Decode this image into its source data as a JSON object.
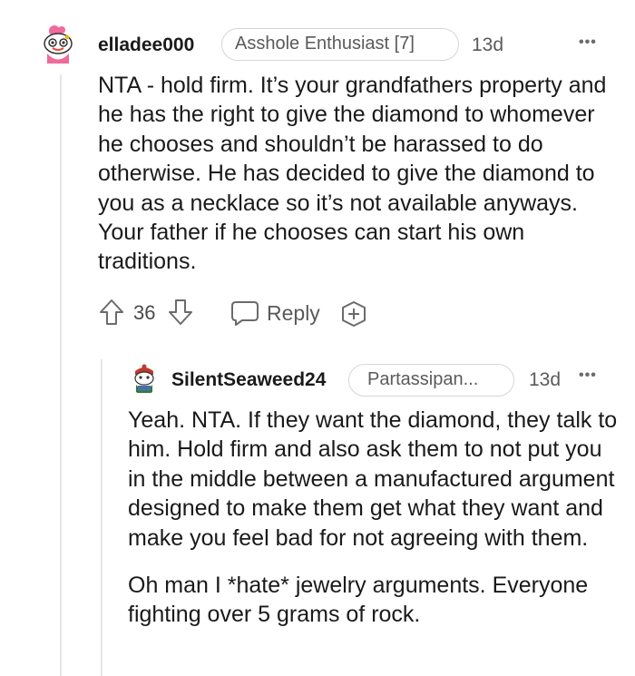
{
  "comment": {
    "username": "elladee000",
    "flair": "Asshole Enthusiast [7]",
    "age": "13d",
    "more": "•••",
    "body": "NTA - hold firm. It’s your grandfathers property and he has the right to give the diamond to whomever he chooses and shouldn’t be harassed to do otherwise. He has decided to give the diamond to you as a necklace so it’s not available anyways. Your father if he chooses can start his own traditions.",
    "votes": "36",
    "reply_label": "Reply"
  },
  "reply": {
    "username": "SilentSeaweed24",
    "flair": "Partassipan...",
    "age": "13d",
    "more": "•••",
    "paragraph1": "Yeah. NTA. If they want the diamond, they talk to him. Hold firm and also ask them to not put you in the middle between a manufactured argument designed to make them get what they want and make you feel bad for not agreeing with them.",
    "paragraph2": "Oh man I *hate* jewelry arguments. Everyone fighting over 5 grams of rock."
  },
  "colors": {
    "text": "#1a1a1b",
    "meta": "#5a5a5a",
    "flair_border": "#d6d6d6",
    "thread_line": "#e6e6e6"
  }
}
